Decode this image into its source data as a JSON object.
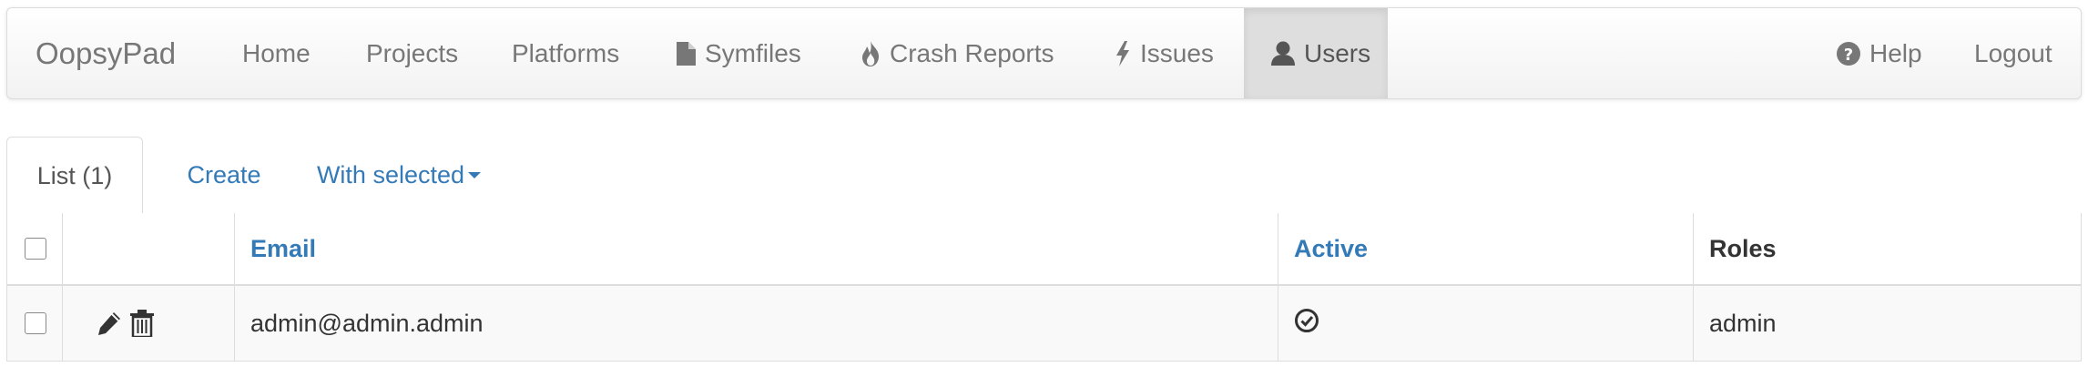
{
  "navbar": {
    "brand": "OopsyPad",
    "items": [
      {
        "label": "Home",
        "icon": ""
      },
      {
        "label": "Projects",
        "icon": ""
      },
      {
        "label": "Platforms",
        "icon": ""
      },
      {
        "label": "Symfiles",
        "icon": "file-icon"
      },
      {
        "label": "Crash Reports",
        "icon": "fire-icon"
      },
      {
        "label": "Issues",
        "icon": "flash-icon"
      },
      {
        "label": "Users",
        "icon": "user-icon",
        "active": true
      }
    ],
    "right": [
      {
        "label": "Help",
        "icon": "question-circle-icon"
      },
      {
        "label": "Logout",
        "icon": ""
      }
    ]
  },
  "tabs": {
    "list_label": "List (1)",
    "create_label": "Create",
    "with_selected_label": "With selected"
  },
  "table": {
    "columns": {
      "email": "Email",
      "active": "Active",
      "roles": "Roles"
    },
    "rows": [
      {
        "email": "admin@admin.admin",
        "active": true,
        "active_icon": "check-circle-icon",
        "roles": "admin",
        "actions": [
          "pencil-icon",
          "trash-icon"
        ]
      }
    ]
  },
  "colors": {
    "link": "#337ab7",
    "nav_text": "#777777",
    "nav_active_bg": "#dedede",
    "border": "#dddddd"
  }
}
